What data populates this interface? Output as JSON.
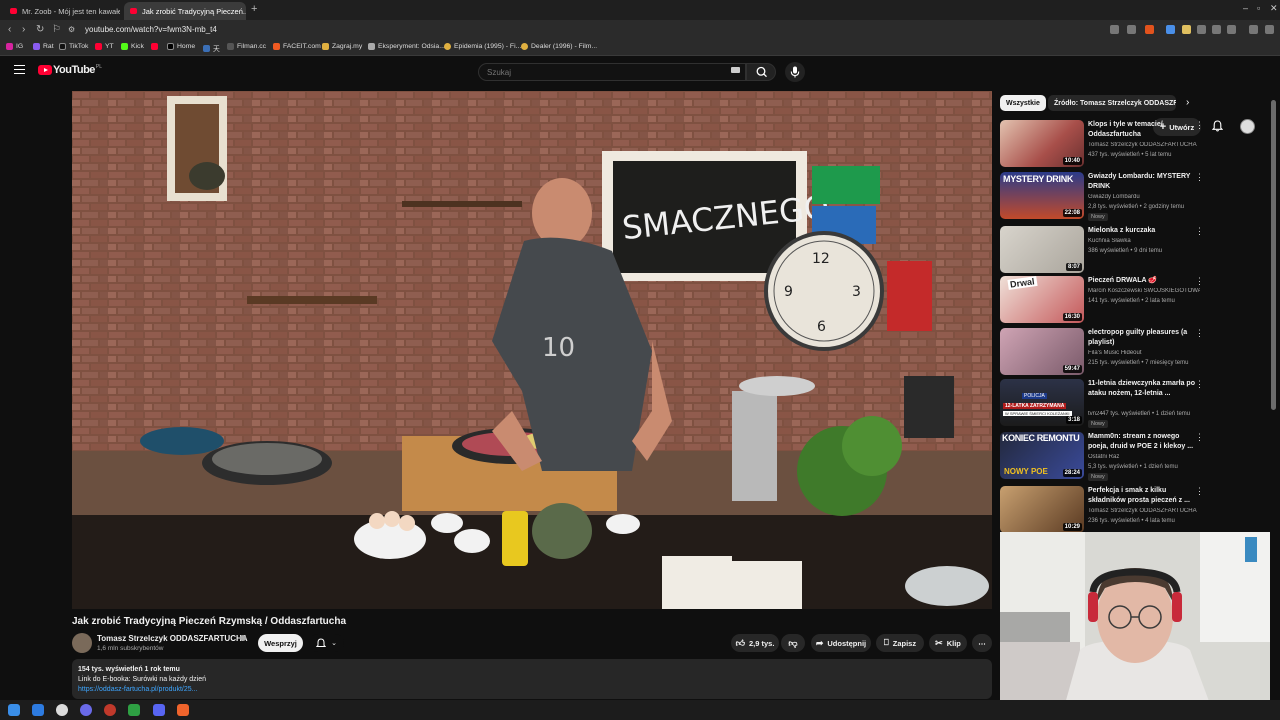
{
  "browser": {
    "tabs": [
      {
        "title": "Mr. Zoob - Mój jest ten kawałek podł...",
        "active": false
      },
      {
        "title": "Jak zrobić Tradycyjną Pieczeń...",
        "active": true
      }
    ],
    "new_tab": "+",
    "url": "youtube.com/watch?v=fwm3N-mb_t4",
    "bookmarks": [
      "IG",
      "Rat",
      "TikTok",
      "YT",
      "Kick",
      "Home",
      "天",
      "Filman.cc",
      "FACEIT.com",
      "Zagraj.my",
      "Eksperyment: Odsia...",
      "Epidemia (1995) - Fi...",
      "Dealer (1996) - Film..."
    ]
  },
  "youtube": {
    "logo_text": "YouTube",
    "country": "PL",
    "search_placeholder": "Szukaj",
    "create_label": "Utwórz"
  },
  "video": {
    "title": "Jak zrobić Tradycyjną Pieczeń Rzymską / Oddaszfartucha",
    "channel": "Tomasz Strzelczyk ODDASZFARTUCHA",
    "subscribers": "1,6 mln subskrybentów",
    "support_label": "Wesprzyj",
    "likes": "2,9 tys.",
    "share_label": "Udostępnij",
    "save_label": "Zapisz",
    "clip_label": "Klip",
    "views_date": "154 tys. wyświetleń  1 rok temu",
    "desc_line": "Link do E-booka:  Surówki na każdy dzień",
    "desc_link": "https://oddasz-fartucha.pl/produkt/25..."
  },
  "chips": [
    "Wszystkie",
    "Źródło: Tomasz Strzelczyk ODDASZFARTUCHA"
  ],
  "recommendations": [
    {
      "title": "Klops i tyle w temacie/ Oddaszfartucha",
      "channel": "Tomasz Strzelczyk ODDASZFARTUCHA",
      "meta": "437 tys. wyświetleń • 5 lat temu",
      "duration": "10:40",
      "badge": "",
      "thumb_color": "#b5706a"
    },
    {
      "title": "Gwiazdy Lombardu: MYSTERY DRINK",
      "channel": "Gwiazdy Lombardu",
      "meta": "2,8 tys. wyświetleń • 2 godziny temu",
      "duration": "22:08",
      "badge": "Nowy",
      "thumb_color": "#3a4fa0"
    },
    {
      "title": "Mielonka z kurczaka",
      "channel": "Kuchnia Sławka",
      "meta": "386 wyświetleń • 9 dni temu",
      "duration": "8:07",
      "badge": "",
      "thumb_color": "#c9c4bc"
    },
    {
      "title": "Pieczeń DRWALA 🥩",
      "channel": "Marcin Koszczewski SWOJSKIEGOTOWA...",
      "meta": "141 tys. wyświetleń • 2 lata temu",
      "duration": "16:30",
      "badge": "",
      "thumb_color": "#c66a68"
    },
    {
      "title": "electropop guilty pleasures (a playlist)",
      "channel": "Fila's Music Hideout",
      "meta": "215 tys. wyświetleń • 7 miesięcy temu",
      "duration": "59:47",
      "badge": "",
      "thumb_color": "#b48aa0"
    },
    {
      "title": "11-letnia dziewczynka zmarła po ataku nożem, 12-letnia ...",
      "channel": "tvn24",
      "meta": "47 tys. wyświetleń • 1 dzień temu",
      "duration": "3:18",
      "badge": "Nowy",
      "thumb_color": "#2c3247"
    },
    {
      "title": "Mamm0n: stream z nowego poeja, druid w POE 2 i klekoy ...",
      "channel": "Ostatni Raz",
      "meta": "5,3 tys. wyświetleń • 1 dzień temu",
      "duration": "28:24",
      "badge": "Nowy",
      "thumb_color": "#27304a"
    },
    {
      "title": "Perfekcja i smak z kilku składników prosta pieczeń z ...",
      "channel": "Tomasz Strzelczyk ODDASZFARTUCHA",
      "meta": "236 tys. wyświetleń • 4 lata temu",
      "duration": "10:29",
      "badge": "",
      "thumb_color": "#7b5a3a"
    }
  ],
  "thumb_texts": [
    "MYSTERY DRINK",
    "Drwal",
    "POLICJA",
    "12-LATKA ZATRZYMANA",
    "W SPRAWIE ŚMIERCI KOLEŻANKI",
    "KONIEC REMONTU",
    "NOWY POE"
  ],
  "video_overlay_text": [
    "SMACZNEGO",
    "10",
    "12",
    "9",
    "3",
    "6"
  ],
  "colors": {
    "accent": "#ff0033",
    "link": "#3ea6ff",
    "bg": "#0f0f0f"
  }
}
